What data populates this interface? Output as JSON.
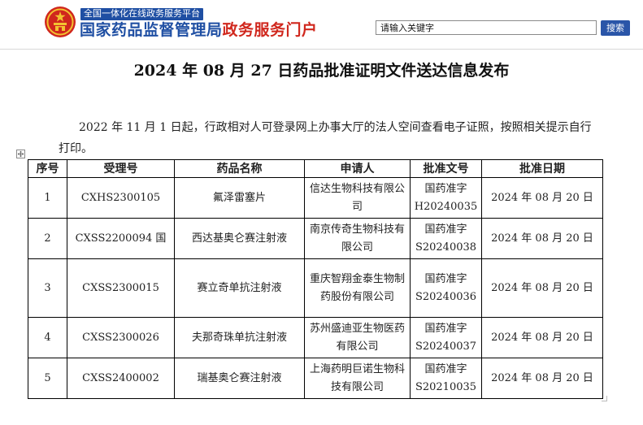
{
  "header": {
    "platform_tag": "全国一体化在线政务服务平台",
    "site_title_primary": "国家药品监督管理局",
    "site_title_secondary": "政务服务门户",
    "search_placeholder": "请输入关键字",
    "search_button": "搜索"
  },
  "page": {
    "title": "2024 年 08 月 27 日药品批准证明文件送达信息发布",
    "intro": "2022 年 11 月 1 日起，行政相对人可登录网上办事大厅的法人空间查看电子证照，按照相关提示自行打印。"
  },
  "table": {
    "headers": [
      "序号",
      "受理号",
      "药品名称",
      "申请人",
      "批准文号",
      "批准日期"
    ],
    "rows": [
      [
        "1",
        "CXHS2300105",
        "氟泽雷塞片",
        "信达生物科技有限公司",
        "国药准字H20240035",
        "2024 年 08 月 20 日"
      ],
      [
        "2",
        "CXSS2200094 国",
        "西达基奥仑赛注射液",
        "南京传奇生物科技有限公司",
        "国药准字S20240038",
        "2024 年 08 月 20 日"
      ],
      [
        "3",
        "CXSS2300015",
        "赛立奇单抗注射液",
        "重庆智翔金泰生物制药股份有限公司",
        "国药准字S20240036",
        "2024 年 08 月 20 日"
      ],
      [
        "4",
        "CXSS2300026",
        "夫那奇珠单抗注射液",
        "苏州盛迪亚生物医药有限公司",
        "国药准字S20240037",
        "2024 年 08 月 20 日"
      ],
      [
        "5",
        "CXSS2400002",
        "瑞基奥仑赛注射液",
        "上海药明巨诺生物科技有限公司",
        "国药准字S20210035",
        "2024 年 08 月 20 日"
      ]
    ]
  },
  "icons": {
    "emblem": "national-emblem-icon",
    "table_handle": "move-icon"
  },
  "colors": {
    "brand_blue": "#1f4fa3",
    "brand_red": "#d0271d",
    "search_button": "#2a55a8"
  }
}
